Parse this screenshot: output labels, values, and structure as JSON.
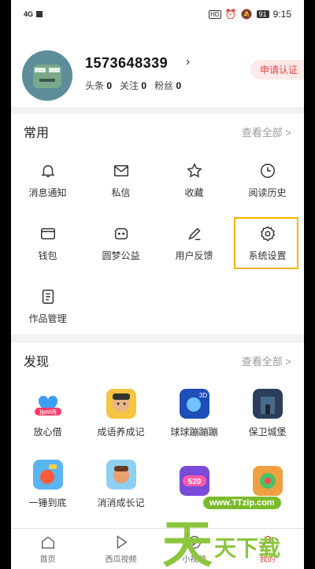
{
  "status_bar": {
    "signal": "4G",
    "time": "9:15",
    "battery": "91",
    "hd": "HD"
  },
  "profile": {
    "phone": "1573648339",
    "stats": [
      {
        "label": "头条",
        "value": "0"
      },
      {
        "label": "关注",
        "value": "0"
      },
      {
        "label": "粉丝",
        "value": "0"
      }
    ],
    "apply_label": "申请认证"
  },
  "common": {
    "title": "常用",
    "more": "查看全部 >",
    "items": [
      {
        "label": "消息通知",
        "icon": "bell-icon"
      },
      {
        "label": "私信",
        "icon": "mail-icon"
      },
      {
        "label": "收藏",
        "icon": "star-icon"
      },
      {
        "label": "阅读历史",
        "icon": "clock-icon"
      },
      {
        "label": "钱包",
        "icon": "wallet-icon"
      },
      {
        "label": "圆梦公益",
        "icon": "charity-icon"
      },
      {
        "label": "用户反馈",
        "icon": "feedback-icon"
      },
      {
        "label": "系统设置",
        "icon": "gear-icon"
      },
      {
        "label": "作品管理",
        "icon": "document-icon"
      }
    ]
  },
  "discover": {
    "title": "发现",
    "more": "查看全部 >",
    "items": [
      {
        "label": "放心借",
        "badge": "抽88两"
      },
      {
        "label": "成语养成记"
      },
      {
        "label": "球球蹦蹦蹦",
        "badge": "3D"
      },
      {
        "label": "保卫城堡"
      },
      {
        "label": "一锤到底"
      },
      {
        "label": "消消成长记"
      },
      {
        "label": "",
        "badge": "520"
      },
      {
        "label": ""
      }
    ]
  },
  "tabs": [
    {
      "label": "首页",
      "icon": "home-icon"
    },
    {
      "label": "西瓜视频",
      "icon": "play-icon"
    },
    {
      "label": "小视频",
      "icon": "small-video-icon"
    },
    {
      "label": "我的",
      "icon": "profile-icon"
    }
  ],
  "watermark": {
    "url": "www.TTzip.com",
    "char": "天",
    "text": "天下载"
  },
  "colors": {
    "accent": "#e04848",
    "highlight": "#f5b400",
    "watermark": "#8cc63f"
  }
}
